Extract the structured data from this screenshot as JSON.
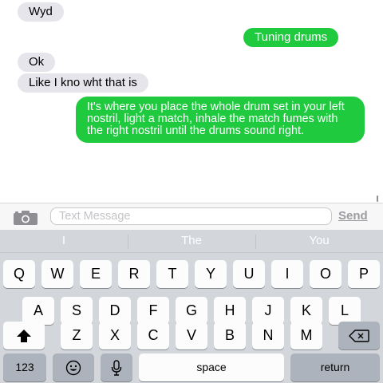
{
  "messages": [
    {
      "direction": "incoming",
      "text": "Wyd"
    },
    {
      "direction": "outgoing",
      "text": "Tuning drums"
    },
    {
      "direction": "incoming",
      "text": "Ok"
    },
    {
      "direction": "incoming",
      "text": "Like I kno wht that is"
    },
    {
      "direction": "outgoing",
      "text": "It's where you place the whole drum set in your left nostril, light a match, inhale the match fumes with the right nostril until the drums sound right."
    }
  ],
  "input_bar": {
    "camera_icon": "camera-icon",
    "placeholder": "Text Message",
    "send_label": "Send"
  },
  "predictive": [
    "I",
    "The",
    "You"
  ],
  "keyboard": {
    "row1": [
      "Q",
      "W",
      "E",
      "R",
      "T",
      "Y",
      "U",
      "I",
      "O",
      "P"
    ],
    "row2": [
      "A",
      "S",
      "D",
      "F",
      "G",
      "H",
      "J",
      "K",
      "L"
    ],
    "row3": [
      "Z",
      "X",
      "C",
      "V",
      "B",
      "N",
      "M"
    ],
    "numbers_label": "123",
    "space_label": "space",
    "return_label": "return",
    "shift_icon": "shift-icon",
    "backspace_icon": "backspace-icon",
    "emoji_icon": "emoji-icon",
    "mic_icon": "microphone-icon"
  },
  "colors": {
    "outgoing_bubble": "#1fca3f",
    "incoming_bubble": "#e6e5eb",
    "keyboard_background": "#d3d6db"
  }
}
